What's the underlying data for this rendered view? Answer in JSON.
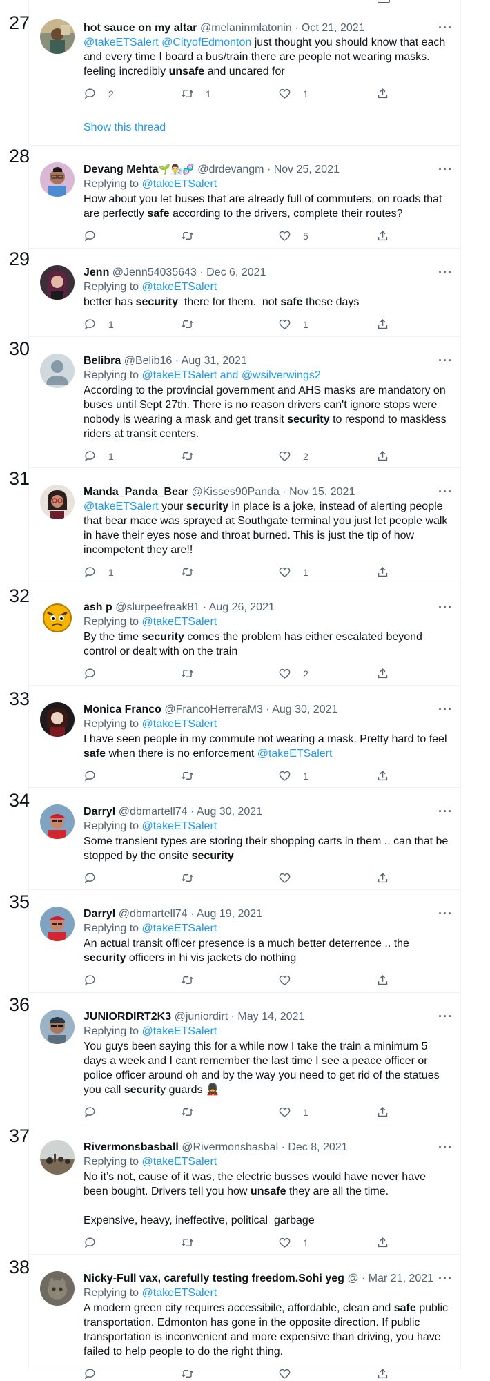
{
  "tweets": [
    {
      "num": "27",
      "name": "hot sauce on my altar",
      "name_suffix": "",
      "handle": "@melaninmlatonin",
      "date": "Oct 21, 2021",
      "replying": "",
      "body_html": "<span class=\"mention\">@takeETSalert @CityofEdmonton</span> just thought you should know that each and every time I board a bus/train there are people not wearing masks. feeling incredibly <b>unsafe</b> and uncared for",
      "replies": "2",
      "retweets": "1",
      "likes": "1",
      "show_thread": "Show this thread",
      "avatar": "photo-altar"
    },
    {
      "num": "28",
      "name": "Devang Mehta",
      "name_suffix": "🌱👨‍🔬🧬",
      "handle": "@drdevangm",
      "date": "Nov 25, 2021",
      "replying": "@takeETSalert",
      "body_html": "How about you let buses that are already full of commuters, on roads that are perfectly <b>safe</b> according to the drivers, complete their routes?",
      "replies": "",
      "retweets": "",
      "likes": "5",
      "show_thread": "",
      "avatar": "photo-man-glasses"
    },
    {
      "num": "29",
      "name": "Jenn",
      "name_suffix": "",
      "handle": "@Jenn54035643",
      "date": "Dec 6, 2021",
      "replying": "@takeETSalert",
      "body_html": "better has <b>security</b> &nbsp;there for them. &nbsp;not <b>safe</b> these days",
      "replies": "1",
      "retweets": "",
      "likes": "1",
      "show_thread": "",
      "avatar": "photo-woman-dark"
    },
    {
      "num": "30",
      "name": "Belibra",
      "name_suffix": "",
      "handle": "@Belib16",
      "date": "Aug 31, 2021",
      "replying": "@takeETSalert and @wsilverwings2",
      "body_html": "According to the provincial government and AHS masks are mandatory on buses until Sept 27th. There is no reason drivers can't ignore stops were nobody is wearing a mask and get transit <b>security</b> to respond to maskless riders at transit centers.",
      "replies": "1",
      "retweets": "",
      "likes": "2",
      "show_thread": "",
      "avatar": "default-silhouette"
    },
    {
      "num": "31",
      "name": "Manda_Panda_Bear",
      "name_suffix": "",
      "handle": "@Kisses90Panda",
      "date": "Nov 15, 2021",
      "replying": "",
      "body_html": "<span class=\"mention\">@takeETSalert</span> your <b>security</b> in place is a joke, instead of alerting people that bear mace was sprayed at Southgate terminal you just let people walk in have their eyes nose and throat burned. This is just the tip of how incompetent they are!!",
      "replies": "1",
      "retweets": "",
      "likes": "1",
      "show_thread": "",
      "avatar": "photo-woman-glasses"
    },
    {
      "num": "32",
      "name": "ash p",
      "name_suffix": "",
      "handle": "@slurpeefreak81",
      "date": "Aug 26, 2021",
      "replying": "@takeETSalert",
      "body_html": "By the time <b>security</b> comes the problem has either escalated beyond control or dealt with on the train",
      "replies": "",
      "retweets": "",
      "likes": "2",
      "show_thread": "",
      "avatar": "angry-bird"
    },
    {
      "num": "33",
      "name": "Monica Franco",
      "name_suffix": "",
      "handle": "@FrancoHerreraM3",
      "date": "Aug 30, 2021",
      "replying": "@takeETSalert",
      "body_html": "I have seen people in my commute not wearing a mask. Pretty hard to feel <b>safe</b> when there is no enforcement <span class=\"mention\">@takeETSalert</span>",
      "replies": "",
      "retweets": "",
      "likes": "1",
      "show_thread": "",
      "avatar": "photo-portrait"
    },
    {
      "num": "34",
      "name": "Darryl",
      "name_suffix": "",
      "handle": "@dbmartell74",
      "date": "Aug 30, 2021",
      "replying": "@takeETSalert",
      "body_html": "Some transient types are storing their shopping carts in them .. can that be stopped by the onsite <b>security</b>",
      "replies": "",
      "retweets": "",
      "likes": "",
      "show_thread": "",
      "avatar": "photo-man-cap"
    },
    {
      "num": "35",
      "name": "Darryl",
      "name_suffix": "",
      "handle": "@dbmartell74",
      "date": "Aug 19, 2021",
      "replying": "@takeETSalert",
      "body_html": "An actual transit officer presence is a much better deterrence .. the <b>security</b> officers in hi vis jackets do nothing",
      "replies": "",
      "retweets": "",
      "likes": "",
      "show_thread": "",
      "avatar": "photo-man-cap"
    },
    {
      "num": "36",
      "name": "JUNIORDIRT2K3",
      "name_suffix": "",
      "handle": "@juniordirt",
      "date": "May 14, 2021",
      "replying": "@takeETSalert",
      "body_html": "You guys been saying this for a while now I take the train a minimum 5 days a week and I cant remember the last time I see a peace officer or police officer around oh and by the way you need to get rid of the statues you call <b>securit</b>y guards 💂",
      "replies": "",
      "retweets": "",
      "likes": "1",
      "show_thread": "",
      "avatar": "photo-man-sunglasses"
    },
    {
      "num": "37",
      "name": "Rivermonsbasball",
      "name_suffix": "",
      "handle": "@Rivermonsbasbal",
      "date": "Dec 8, 2021",
      "replying": "@takeETSalert",
      "body_html": "No it’s not, cause of it was, the electric busses would have never have been bought. Drivers tell you how <b>unsafe</b> they are all the time.<br><br>Expensive, heavy, ineffective, political &nbsp;garbage",
      "replies": "",
      "retweets": "",
      "likes": "1",
      "show_thread": "",
      "avatar": "photo-landscape"
    },
    {
      "num": "38",
      "name": "Nicky-Full vax, carefully testing freedom.Sohi yeg",
      "name_suffix": "",
      "handle": "@",
      "date": "Mar 21, 2021",
      "replying": "@takeETSalert",
      "body_html": "A modern green city requires accessibile, affordable, clean and <b>safe</b> public transportation. Edmonton has gone in the opposite direction. If public transportation is inconvenient and more expensive than driving, you have failed to help people to do the right thing.",
      "replies": "",
      "retweets": "",
      "likes": "",
      "show_thread": "",
      "avatar": "photo-cat"
    }
  ],
  "labels": {
    "replying_prefix": "Replying to",
    "more": "···",
    "dot": "·"
  },
  "colors": {
    "link": "#1d9bf0",
    "muted": "#536471",
    "text": "#0f1419",
    "divider": "#eff3f4"
  }
}
